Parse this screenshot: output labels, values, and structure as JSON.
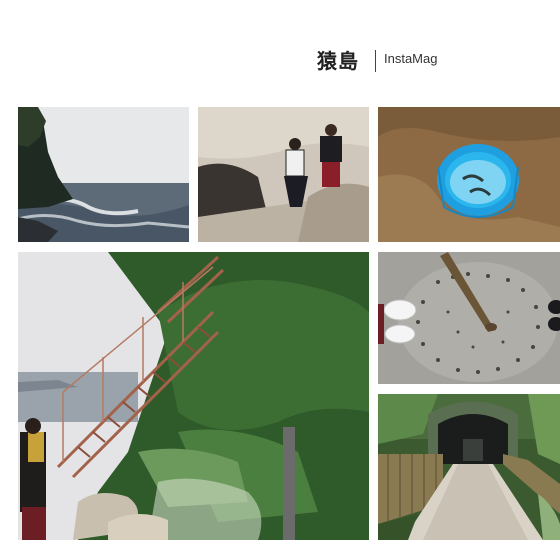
{
  "header": {
    "title": "猿島",
    "subtitle": "InstaMag"
  },
  "photos": [
    {
      "id": "coast",
      "icon": "sea-rocks-photo"
    },
    {
      "id": "friends",
      "icon": "two-girls-on-rock-photo"
    },
    {
      "id": "bucket",
      "icon": "blue-bucket-photo"
    },
    {
      "id": "stairs",
      "icon": "metal-stairs-photo"
    },
    {
      "id": "feet",
      "icon": "feet-on-ground-photo"
    },
    {
      "id": "tunnel",
      "icon": "tunnel-path-photo"
    }
  ],
  "colors": {
    "background": "#ffffff",
    "bucket": "#22a8e8",
    "foliage": "#2f5a2a",
    "sea": "#5f6e7d"
  }
}
